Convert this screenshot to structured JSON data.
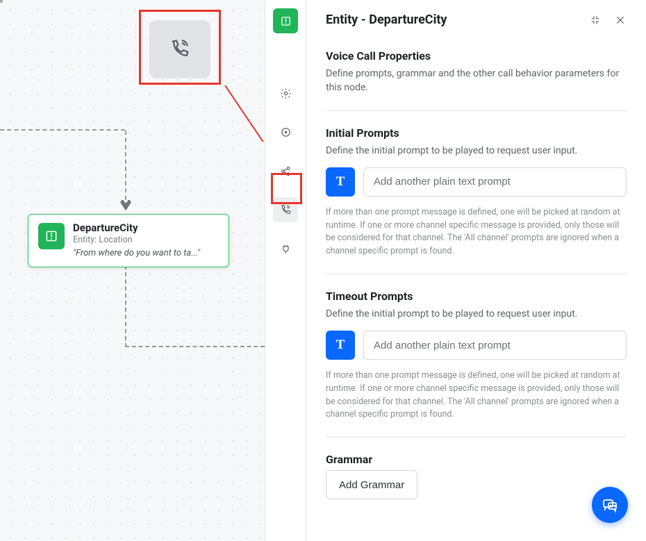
{
  "panel": {
    "title": "Entity - DepartureCity",
    "voice_section": {
      "heading": "Voice Call Properties",
      "description": "Define prompts, grammar and the other call behavior parameters for this node."
    },
    "initial_prompts": {
      "heading": "Initial Prompts",
      "description": "Define the initial prompt to be played to request user input.",
      "placeholder": "Add another plain text prompt",
      "note": "If more than one prompt message is defined, one will be picked at random at runtime. If one or more channel specific message is provided, only those will be considered for that channel. The 'All channel' prompts are ignored when a channel specific prompt is found."
    },
    "timeout_prompts": {
      "heading": "Timeout Prompts",
      "description": "Define the initial prompt to be played to request user input.",
      "placeholder": "Add another plain text prompt",
      "note": "If more than one prompt message is defined, one will be picked at random at runtime. If one or more channel specific message is provided, only those will be considered for that channel. The 'All channel' prompts are ignored when a channel specific prompt is found."
    },
    "grammar": {
      "heading": "Grammar",
      "button": "Add Grammar"
    }
  },
  "node": {
    "title": "DepartureCity",
    "subtitle": "Entity: Location",
    "prompt": "\"From where do you want to ta...\""
  },
  "rail": {
    "items": [
      "entity",
      "settings",
      "record",
      "share",
      "voice",
      "plug"
    ]
  },
  "icons": {
    "t_label": "T"
  }
}
